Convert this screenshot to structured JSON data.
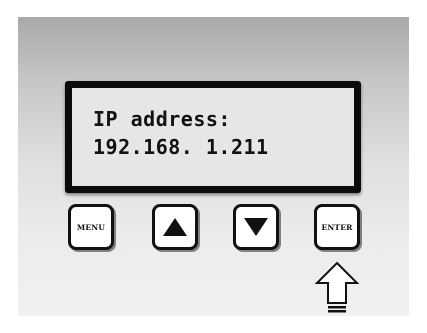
{
  "display": {
    "line1": "IP address:",
    "line2": "192.168. 1.211"
  },
  "keys": {
    "menu_label": "MENU",
    "up_icon": "triangle-up-icon",
    "down_icon": "triangle-down-icon",
    "enter_label": "ENTER"
  },
  "indicator": {
    "icon": "outline-arrow-up-icon",
    "points_to": "enter"
  },
  "colors": {
    "lcd_background": "#e6e6e6",
    "bezel": "#0b0b0b",
    "panel_top": "#a9a9a9",
    "panel_bottom": "#f1f1f1"
  }
}
